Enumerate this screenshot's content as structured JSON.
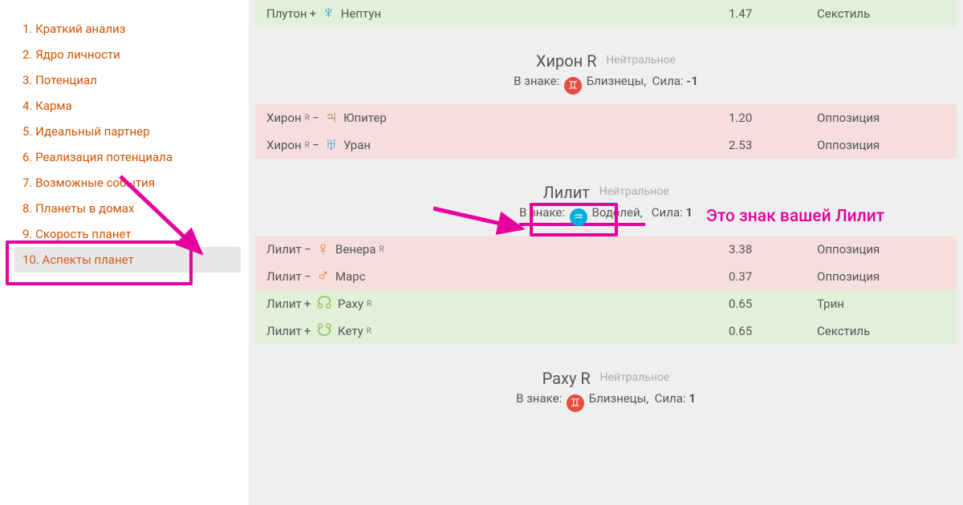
{
  "sidebar": {
    "items": [
      {
        "label": "1. Краткий анализ"
      },
      {
        "label": "2. Ядро личности"
      },
      {
        "label": "3. Потенциал"
      },
      {
        "label": "4. Карма"
      },
      {
        "label": "5. Идеальный партнер"
      },
      {
        "label": "6. Реализация потенциала"
      },
      {
        "label": "7. Возможные события"
      },
      {
        "label": "8. Планеты в домах"
      },
      {
        "label": "9. Скорость планет"
      },
      {
        "label": "10. Аспекты планет"
      }
    ]
  },
  "annotation": {
    "text": "Это знак вашей Лилит"
  },
  "common": {
    "in_sign_prefix": "В знаке:",
    "strength_label": "Сила:",
    "retro": "R",
    "sign_comma": ","
  },
  "top_row": {
    "left1": "Плутон",
    "op": "+",
    "right": "Нептун",
    "orb": "1.47",
    "aspect": "Секстиль"
  },
  "section_chiron": {
    "title": "Хирон R",
    "note": "Нейтральное",
    "sign": "Близнецы",
    "strength": "-1",
    "rows": [
      {
        "left": "Хирон",
        "lretro": true,
        "op": "−",
        "right": "Юпитер",
        "rretro": false,
        "orb": "1.20",
        "aspect": "Оппозиция",
        "cls": "neg"
      },
      {
        "left": "Хирон",
        "lretro": true,
        "op": "−",
        "right": "Уран",
        "rretro": false,
        "orb": "2.53",
        "aspect": "Оппозиция",
        "cls": "neg"
      }
    ]
  },
  "section_lilith": {
    "title": "Лилит",
    "note": "Нейтральное",
    "sign": "Водолей",
    "strength": "1",
    "rows": [
      {
        "left": "Лилит",
        "lretro": false,
        "op": "−",
        "right": "Венера",
        "rretro": true,
        "orb": "3.38",
        "aspect": "Оппозиция",
        "cls": "neg"
      },
      {
        "left": "Лилит",
        "lretro": false,
        "op": "−",
        "right": "Марс",
        "rretro": false,
        "orb": "0.37",
        "aspect": "Оппозиция",
        "cls": "neg"
      },
      {
        "left": "Лилит",
        "lretro": false,
        "op": "+",
        "right": "Раху",
        "rretro": true,
        "orb": "0.65",
        "aspect": "Трин",
        "cls": "pos"
      },
      {
        "left": "Лилит",
        "lretro": false,
        "op": "+",
        "right": "Кету",
        "rretro": true,
        "orb": "0.65",
        "aspect": "Секстиль",
        "cls": "pos"
      }
    ]
  },
  "section_rahu": {
    "title": "Раху R",
    "note": "Нейтральное",
    "sign": "Близнецы",
    "strength": "1"
  },
  "icons": {
    "neptune_color": "#1ca0c7",
    "jupiter_color": "#b07d3e",
    "uranus_color": "#2ea3d6",
    "venus_color": "#e67e22",
    "mars_color": "#e67e22",
    "rahu_color": "#9cc96a",
    "ketu_color": "#9cc96a"
  }
}
